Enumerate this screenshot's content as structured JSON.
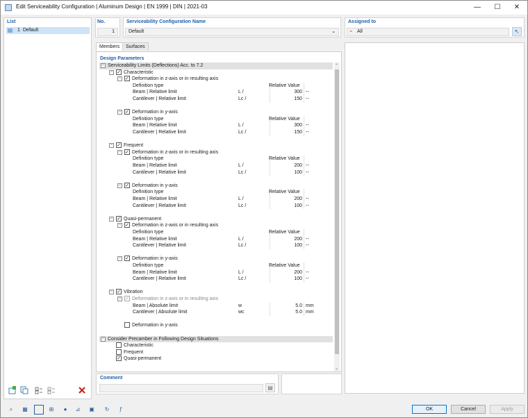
{
  "window": {
    "title": "Edit Serviceability Configuration | Aluminum Design | EN 1999 | DIN | 2021-03",
    "minimize": "—",
    "maximize": "☐",
    "close": "✕"
  },
  "list": {
    "label": "List",
    "items": [
      {
        "num": "1",
        "name": "Default"
      }
    ]
  },
  "no": {
    "label": "No.",
    "value": "1"
  },
  "config_name": {
    "label": "Serviceability Configuration Name",
    "value": "Default"
  },
  "assigned": {
    "label": "Assigned to",
    "value": "All"
  },
  "tabs": [
    {
      "label": "Members"
    },
    {
      "label": "Surfaces"
    }
  ],
  "design_parameters": {
    "label": "Design Parameters"
  },
  "tree": [
    {
      "level": 0,
      "type": "group",
      "expand": "−",
      "label": "Serviceability Limits (Deflections) Acc. to 7.2"
    },
    {
      "level": 1,
      "type": "check",
      "expand": "−",
      "checked": true,
      "label": "Characteristic"
    },
    {
      "level": 2,
      "type": "check",
      "expand": "−",
      "checked": true,
      "label": "Deformation in z-axis or in resulting axis"
    },
    {
      "level": 3,
      "type": "param",
      "label": "Definition type",
      "value": "Relative Value",
      "valtype": "text"
    },
    {
      "level": 3,
      "type": "param",
      "label": "Beam | Relative limit",
      "sym": "L /",
      "value": "300",
      "unit": "--"
    },
    {
      "level": 3,
      "type": "param",
      "label": "Cantilever | Relative limit",
      "sym": "Lc /",
      "value": "150",
      "unit": "--"
    },
    {
      "level": 3,
      "type": "blank"
    },
    {
      "level": 2,
      "type": "check",
      "expand": "−",
      "checked": true,
      "label": "Deformation in y-axis"
    },
    {
      "level": 3,
      "type": "param",
      "label": "Definition type",
      "value": "Relative Value",
      "valtype": "text"
    },
    {
      "level": 3,
      "type": "param",
      "label": "Beam | Relative limit",
      "sym": "L /",
      "value": "300",
      "unit": "--"
    },
    {
      "level": 3,
      "type": "param",
      "label": "Cantilever | Relative limit",
      "sym": "Lc /",
      "value": "150",
      "unit": "--"
    },
    {
      "level": 3,
      "type": "blank"
    },
    {
      "level": 1,
      "type": "check",
      "expand": "−",
      "checked": true,
      "label": "Frequent"
    },
    {
      "level": 2,
      "type": "check",
      "expand": "−",
      "checked": true,
      "label": "Deformation in z-axis or in resulting axis"
    },
    {
      "level": 3,
      "type": "param",
      "label": "Definition type",
      "value": "Relative Value",
      "valtype": "text"
    },
    {
      "level": 3,
      "type": "param",
      "label": "Beam | Relative limit",
      "sym": "L /",
      "value": "200",
      "unit": "--"
    },
    {
      "level": 3,
      "type": "param",
      "label": "Cantilever | Relative limit",
      "sym": "Lc /",
      "value": "100",
      "unit": "--"
    },
    {
      "level": 3,
      "type": "blank"
    },
    {
      "level": 2,
      "type": "check",
      "expand": "−",
      "checked": true,
      "label": "Deformation in y-axis"
    },
    {
      "level": 3,
      "type": "param",
      "label": "Definition type",
      "value": "Relative Value",
      "valtype": "text"
    },
    {
      "level": 3,
      "type": "param",
      "label": "Beam | Relative limit",
      "sym": "L /",
      "value": "200",
      "unit": "--"
    },
    {
      "level": 3,
      "type": "param",
      "label": "Cantilever | Relative limit",
      "sym": "Lc /",
      "value": "100",
      "unit": "--"
    },
    {
      "level": 3,
      "type": "blank"
    },
    {
      "level": 1,
      "type": "check",
      "expand": "−",
      "checked": true,
      "label": "Quasi-permanent"
    },
    {
      "level": 2,
      "type": "check",
      "expand": "−",
      "checked": true,
      "label": "Deformation in z-axis or in resulting axis"
    },
    {
      "level": 3,
      "type": "param",
      "label": "Definition type",
      "value": "Relative Value",
      "valtype": "text"
    },
    {
      "level": 3,
      "type": "param",
      "label": "Beam | Relative limit",
      "sym": "L /",
      "value": "200",
      "unit": "--"
    },
    {
      "level": 3,
      "type": "param",
      "label": "Cantilever | Relative limit",
      "sym": "Lc /",
      "value": "100",
      "unit": "--"
    },
    {
      "level": 3,
      "type": "blank"
    },
    {
      "level": 2,
      "type": "check",
      "expand": "−",
      "checked": true,
      "label": "Deformation in y-axis"
    },
    {
      "level": 3,
      "type": "param",
      "label": "Definition type",
      "value": "Relative Value",
      "valtype": "text"
    },
    {
      "level": 3,
      "type": "param",
      "label": "Beam | Relative limit",
      "sym": "L /",
      "value": "200",
      "unit": "--"
    },
    {
      "level": 3,
      "type": "param",
      "label": "Cantilever | Relative limit",
      "sym": "Lc /",
      "value": "100",
      "unit": "--"
    },
    {
      "level": 3,
      "type": "blank"
    },
    {
      "level": 1,
      "type": "check",
      "expand": "−",
      "checked": true,
      "label": "Vibration"
    },
    {
      "level": 2,
      "type": "check",
      "expand": "−",
      "checked": true,
      "disabled": true,
      "label": "Deformation in z-axis or in resulting axis"
    },
    {
      "level": 3,
      "type": "param",
      "label": "Beam | Absolute limit",
      "sym": "w",
      "value": "5.0",
      "unit": "mm"
    },
    {
      "level": 3,
      "type": "param",
      "label": "Cantilever | Absolute limit",
      "sym": "wc",
      "value": "5.0",
      "unit": "mm"
    },
    {
      "level": 3,
      "type": "blank"
    },
    {
      "level": 2,
      "type": "check",
      "checked": false,
      "label": "Deformation in y-axis"
    },
    {
      "level": 3,
      "type": "blank"
    },
    {
      "level": 0,
      "type": "group",
      "expand": "−",
      "label": "Consider Precamber in Following Design Situations"
    },
    {
      "level": 1,
      "type": "check",
      "checked": false,
      "label": "Characteristic"
    },
    {
      "level": 1,
      "type": "check",
      "checked": false,
      "label": "Frequent"
    },
    {
      "level": 1,
      "type": "check",
      "checked": true,
      "label": "Quasi-permanent"
    }
  ],
  "comment": {
    "label": "Comment",
    "value": ""
  },
  "buttons": {
    "ok": "OK",
    "cancel": "Cancel",
    "apply": "Apply"
  },
  "colors": {
    "accent": "#1f5fa8",
    "selection": "#cde3f7",
    "group_row": "#e1e1e1"
  }
}
